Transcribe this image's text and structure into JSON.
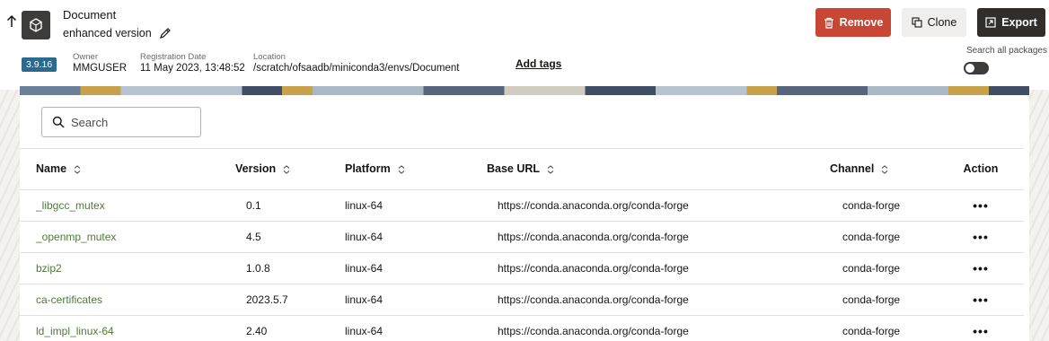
{
  "header": {
    "title": "Document",
    "subtitle": "enhanced version",
    "version": "3.9.16",
    "owner_label": "Owner",
    "owner": "MMGUSER",
    "reg_label": "Registration Date",
    "reg_date": "11 May 2023, 13:48:52",
    "location_label": "Location",
    "location": "/scratch/ofsaadb/miniconda3/envs/Document",
    "add_tags": "Add tags",
    "search_all": "Search all packages",
    "search_all_enabled": false
  },
  "buttons": {
    "remove": "Remove",
    "clone": "Clone",
    "export": "Export"
  },
  "search": {
    "placeholder": "Search",
    "value": ""
  },
  "table": {
    "columns": [
      "Name",
      "Version",
      "Platform",
      "Base URL",
      "Channel",
      "Action"
    ],
    "rows": [
      {
        "name": "_libgcc_mutex",
        "version": "0.1",
        "platform": "linux-64",
        "base_url": "https://conda.anaconda.org/conda-forge",
        "channel": "conda-forge",
        "action": "•••"
      },
      {
        "name": "_openmp_mutex",
        "version": "4.5",
        "platform": "linux-64",
        "base_url": "https://conda.anaconda.org/conda-forge",
        "channel": "conda-forge",
        "action": "•••"
      },
      {
        "name": "bzip2",
        "version": "1.0.8",
        "platform": "linux-64",
        "base_url": "https://conda.anaconda.org/conda-forge",
        "channel": "conda-forge",
        "action": "•••"
      },
      {
        "name": "ca-certificates",
        "version": "2023.5.7",
        "platform": "linux-64",
        "base_url": "https://conda.anaconda.org/conda-forge",
        "channel": "conda-forge",
        "action": "•••"
      },
      {
        "name": "ld_impl_linux-64",
        "version": "2.40",
        "platform": "linux-64",
        "base_url": "https://conda.anaconda.org/conda-forge",
        "channel": "conda-forge",
        "action": "•••"
      }
    ]
  },
  "colors": {
    "remove_button": "#c74634",
    "export_button": "#312d2a",
    "version_badge": "#2b6a8f",
    "package_link": "#4e7a3a"
  },
  "icons": [
    "back-arrow-icon",
    "package-icon",
    "pencil-icon",
    "trash-icon",
    "copy-icon",
    "export-icon",
    "search-icon",
    "sort-icon",
    "ellipsis-icon"
  ]
}
